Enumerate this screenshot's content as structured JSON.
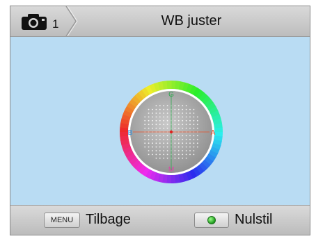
{
  "header": {
    "camera_mode_number": "1",
    "title": "WB juster"
  },
  "wb_grid": {
    "axis_top": "G",
    "axis_bottom": "M",
    "axis_left": "B",
    "axis_right": "A",
    "colors": {
      "G": "#2fa84f",
      "M": "#e040a8",
      "B": "#2a8ee0",
      "A": "#e8502a",
      "center_dot": "#e02020"
    }
  },
  "footer": {
    "menu_button_label": "MENU",
    "back_label": "Tilbage",
    "reset_label": "Nulstil"
  }
}
